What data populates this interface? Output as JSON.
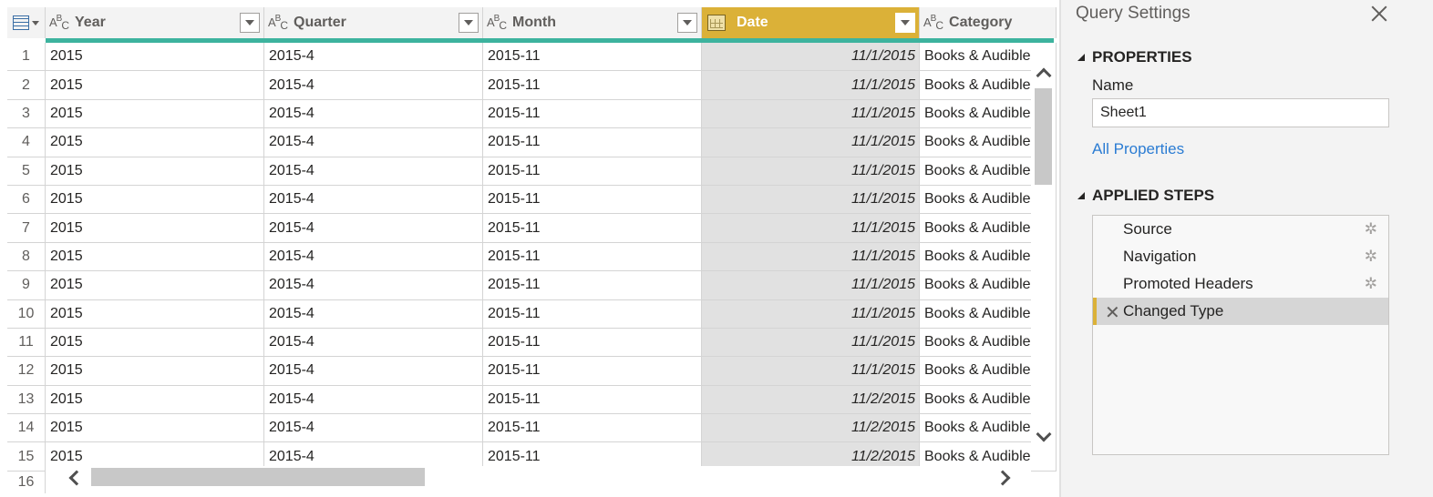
{
  "grid": {
    "columns": [
      {
        "name": "Year",
        "type_icon": "abc-text-icon"
      },
      {
        "name": "Quarter",
        "type_icon": "abc-text-icon"
      },
      {
        "name": "Month",
        "type_icon": "abc-text-icon"
      },
      {
        "name": "Date",
        "type_icon": "calendar-date-icon",
        "selected": true
      },
      {
        "name": "Category",
        "type_icon": "abc-text-icon"
      }
    ],
    "rows": [
      {
        "n": "1",
        "year": "2015",
        "quarter": "2015-4",
        "month": "2015-11",
        "date": "11/1/2015",
        "category": "Books & Audible"
      },
      {
        "n": "2",
        "year": "2015",
        "quarter": "2015-4",
        "month": "2015-11",
        "date": "11/1/2015",
        "category": "Books & Audible"
      },
      {
        "n": "3",
        "year": "2015",
        "quarter": "2015-4",
        "month": "2015-11",
        "date": "11/1/2015",
        "category": "Books & Audible"
      },
      {
        "n": "4",
        "year": "2015",
        "quarter": "2015-4",
        "month": "2015-11",
        "date": "11/1/2015",
        "category": "Books & Audible"
      },
      {
        "n": "5",
        "year": "2015",
        "quarter": "2015-4",
        "month": "2015-11",
        "date": "11/1/2015",
        "category": "Books & Audible"
      },
      {
        "n": "6",
        "year": "2015",
        "quarter": "2015-4",
        "month": "2015-11",
        "date": "11/1/2015",
        "category": "Books & Audible"
      },
      {
        "n": "7",
        "year": "2015",
        "quarter": "2015-4",
        "month": "2015-11",
        "date": "11/1/2015",
        "category": "Books & Audible"
      },
      {
        "n": "8",
        "year": "2015",
        "quarter": "2015-4",
        "month": "2015-11",
        "date": "11/1/2015",
        "category": "Books & Audible"
      },
      {
        "n": "9",
        "year": "2015",
        "quarter": "2015-4",
        "month": "2015-11",
        "date": "11/1/2015",
        "category": "Books & Audible"
      },
      {
        "n": "10",
        "year": "2015",
        "quarter": "2015-4",
        "month": "2015-11",
        "date": "11/1/2015",
        "category": "Books & Audible"
      },
      {
        "n": "11",
        "year": "2015",
        "quarter": "2015-4",
        "month": "2015-11",
        "date": "11/1/2015",
        "category": "Books & Audible"
      },
      {
        "n": "12",
        "year": "2015",
        "quarter": "2015-4",
        "month": "2015-11",
        "date": "11/1/2015",
        "category": "Books & Audible"
      },
      {
        "n": "13",
        "year": "2015",
        "quarter": "2015-4",
        "month": "2015-11",
        "date": "11/2/2015",
        "category": "Books & Audible"
      },
      {
        "n": "14",
        "year": "2015",
        "quarter": "2015-4",
        "month": "2015-11",
        "date": "11/2/2015",
        "category": "Books & Audible"
      },
      {
        "n": "15",
        "year": "2015",
        "quarter": "2015-4",
        "month": "2015-11",
        "date": "11/2/2015",
        "category": "Books & Audible"
      }
    ],
    "partial_row_number": "16",
    "colors": {
      "selected_header": "#dbb138",
      "quality_bar": "#3db39e"
    }
  },
  "query_settings": {
    "title": "Query Settings",
    "properties_heading": "PROPERTIES",
    "name_label": "Name",
    "name_value": "Sheet1",
    "all_properties_link": "All Properties",
    "applied_steps_heading": "APPLIED STEPS",
    "steps": [
      {
        "label": "Source",
        "icon": "gear-icon"
      },
      {
        "label": "Navigation",
        "icon": "gear-icon"
      },
      {
        "label": "Promoted Headers",
        "icon": "gear-icon"
      },
      {
        "label": "Changed Type",
        "icon": "delete-x-icon",
        "active": true
      }
    ],
    "link_color": "#2b7cd3"
  }
}
